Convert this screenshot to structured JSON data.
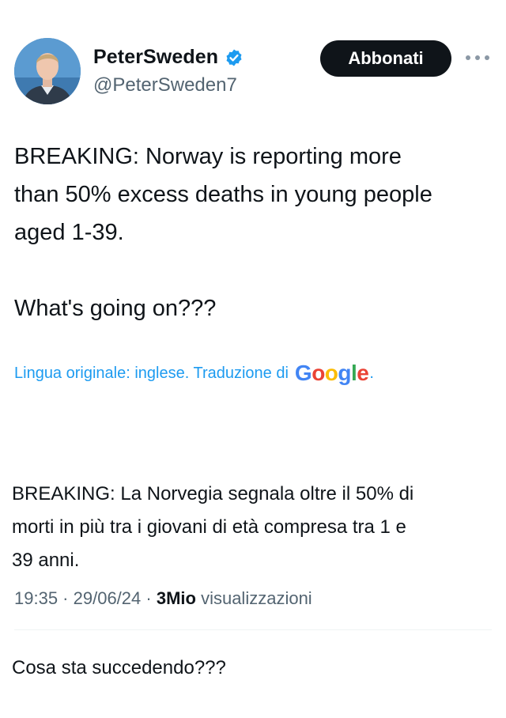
{
  "author": {
    "display_name": "PeterSweden",
    "handle": "@PeterSweden7",
    "verified_icon": "verified-badge-icon",
    "verified_color": "#1d9bf0"
  },
  "follow_button": {
    "label": "Abbonati",
    "background": "#0f1419",
    "color": "#ffffff"
  },
  "more_menu": {
    "icon": "more-horizontal-icon"
  },
  "tweet": {
    "text": "BREAKING: Norway is reporting more\nthan 50% excess deaths in young people\naged 1-39.\n\nWhat's going on???"
  },
  "translation": {
    "note": "Lingua originale: inglese. Traduzione di",
    "provider": "Google",
    "paragraphs": [
      "BREAKING: La Norvegia segnala oltre il 50% di\nmorti in più tra i giovani di età compresa tra 1 e\n39 anni.",
      "Cosa sta succedendo???"
    ]
  },
  "meta": {
    "time": "19:35",
    "date": "29/06/24",
    "separator": " · ",
    "views_count": "3Mio",
    "views_label": "visualizzazioni"
  },
  "colors": {
    "accent": "#1d9bf0",
    "text": "#0f1419",
    "muted": "#536471"
  }
}
